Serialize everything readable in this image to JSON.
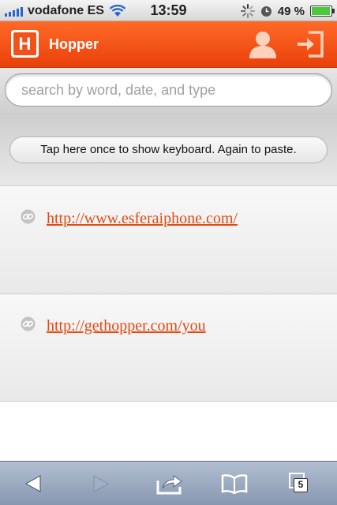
{
  "status_bar": {
    "carrier": "vodafone ES",
    "time": "13:59",
    "battery_percent": "49 %",
    "battery_level": 0.49
  },
  "header": {
    "logo_letter": "H",
    "app_title": "Hopper",
    "accent_color": "#f2521a"
  },
  "search": {
    "placeholder": "search by word, date, and type",
    "value": ""
  },
  "paste_hint": "Tap here once to show keyboard. Again to paste.",
  "links": [
    {
      "url": "http://www.esferaiphone.com/",
      "icon": "link-icon"
    },
    {
      "url": "http://gethopper.com/you",
      "icon": "link-icon"
    }
  ],
  "toolbar": {
    "tabs_count": "5",
    "icons": [
      "back-icon",
      "forward-icon",
      "share-icon",
      "bookmarks-icon",
      "tabs-icon"
    ]
  }
}
